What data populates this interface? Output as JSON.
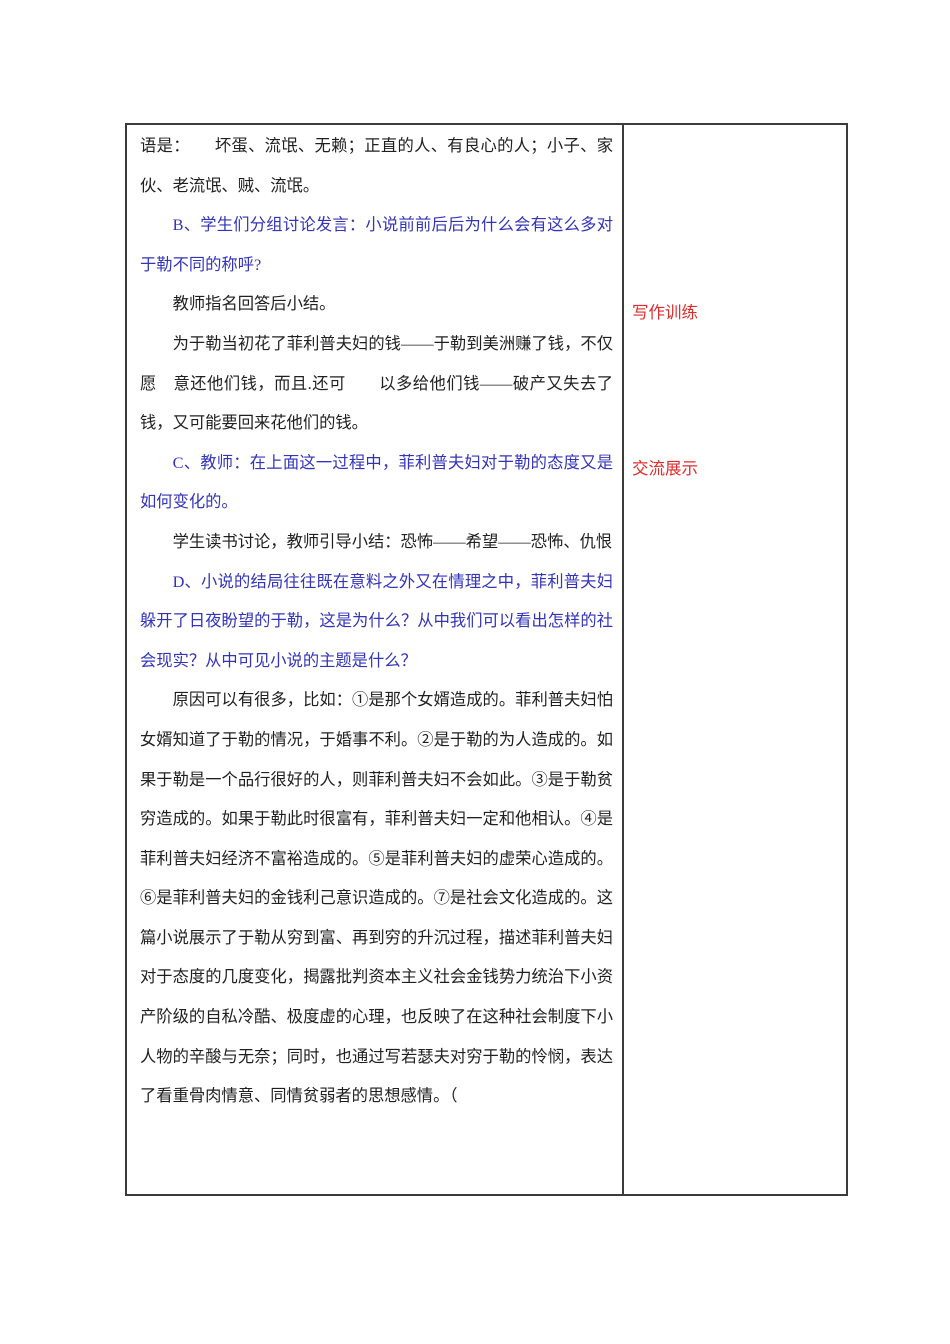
{
  "colors": {
    "page_background": "#ffffff",
    "body_text": "#1f1f1f",
    "blue_text": "#3333bb",
    "red_text": "#e02b2b",
    "table_border": "#3b3b3b"
  },
  "left_column": {
    "paragraphs": [
      {
        "color": "black",
        "indent": false,
        "text": "语是：　　坏蛋、流氓、无赖；正直的人、有良心的人；小子、家伙、老流氓、贼、流氓。"
      },
      {
        "color": "blue",
        "indent": true,
        "text": "B、学生们分组讨论发言：小说前前后后为什么会有这么多对于勒不同的称呼?"
      },
      {
        "color": "black",
        "indent": true,
        "text": "教师指名回答后小结。"
      },
      {
        "color": "black",
        "indent": true,
        "text": "为于勒当初花了菲利普夫妇的钱——于勒到美洲赚了钱，不仅愿　意还他们钱，而且.还可　　以多给他们钱——破产又失去了钱，又可能要回来花他们的钱。"
      },
      {
        "color": "blue",
        "indent": true,
        "text": "C、教师：在上面这一过程中，菲利普夫妇对于勒的态度又是如何变化的。"
      },
      {
        "color": "black",
        "indent": true,
        "text": "学生读书讨论，教师引导小结：恐怖——希望——恐怖、仇恨"
      },
      {
        "color": "blue",
        "indent": true,
        "text": "D、小说的结局往往既在意料之外又在情理之中，菲利普夫妇躲开了日夜盼望的于勒，这是为什么？从中我们可以看出怎样的社会现实？从中可见小说的主题是什么？"
      },
      {
        "color": "black",
        "indent": true,
        "text": "原因可以有很多，比如：①是那个女婿造成的。菲利普夫妇怕女婿知道了于勒的情况，于婚事不利。②是于勒的为人造成的。如果于勒是一个品行很好的人，则菲利普夫妇不会如此。③是于勒贫穷造成的。如果于勒此时很富有，菲利普夫妇一定和他相认。④是菲利普夫妇经济不富裕造成的。⑤是菲利普夫妇的虚荣心造成的。⑥是菲利普夫妇的金钱利己意识造成的。⑦是社会文化造成的。这篇小说展示了于勒从穷到富、再到穷的升沉过程，描述菲利普夫妇对于态度的几度变化，揭露批判资本主义社会金钱势力统治下小资产阶级的自私冷酷、极度虚的心理，也反映了在这种社会制度下小人物的辛酸与无奈；同时，也通过写若瑟夫对穷于勒的怜悯，表达了看重骨肉情意、同情贫弱者的思想感情。（"
      }
    ]
  },
  "right_column": {
    "annotations": [
      {
        "color": "red",
        "label": "写作训练"
      },
      {
        "color": "red",
        "label": "交流展示"
      }
    ]
  }
}
